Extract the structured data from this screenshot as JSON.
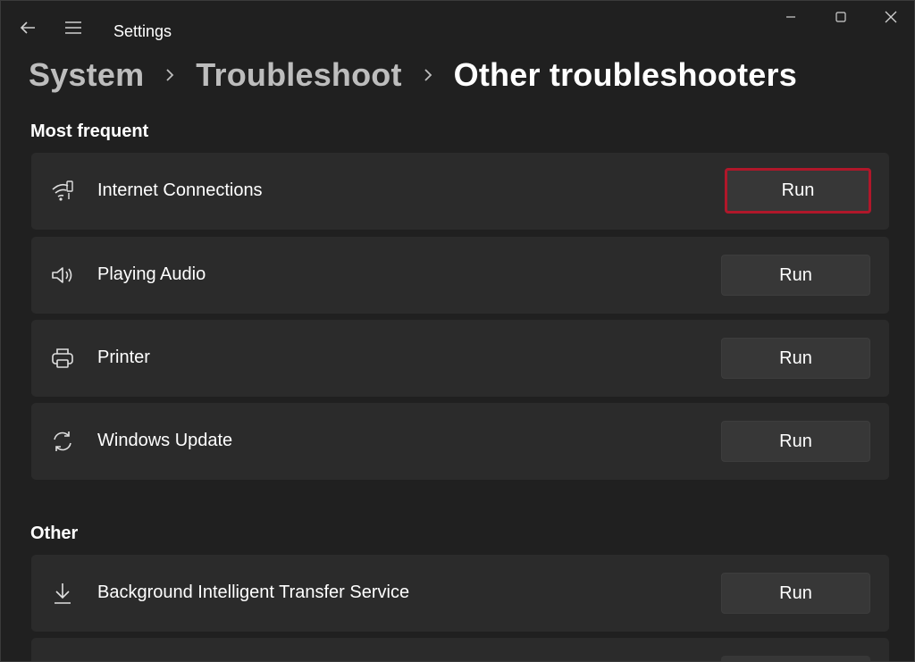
{
  "window": {
    "title": "Settings"
  },
  "breadcrumb": [
    "System",
    "Troubleshoot",
    "Other troubleshooters"
  ],
  "sections": {
    "most_frequent": {
      "title": "Most frequent",
      "items": [
        {
          "label": "Internet Connections",
          "icon": "wifi-icon",
          "button": "Run"
        },
        {
          "label": "Playing Audio",
          "icon": "speaker-icon",
          "button": "Run"
        },
        {
          "label": "Printer",
          "icon": "printer-icon",
          "button": "Run"
        },
        {
          "label": "Windows Update",
          "icon": "sync-icon",
          "button": "Run"
        }
      ]
    },
    "other": {
      "title": "Other",
      "items": [
        {
          "label": "Background Intelligent Transfer Service",
          "icon": "download-icon",
          "button": "Run"
        }
      ]
    }
  },
  "colors": {
    "background": "#202020",
    "card": "#2b2b2b",
    "button": "#373737",
    "highlight": "#b0172a"
  }
}
